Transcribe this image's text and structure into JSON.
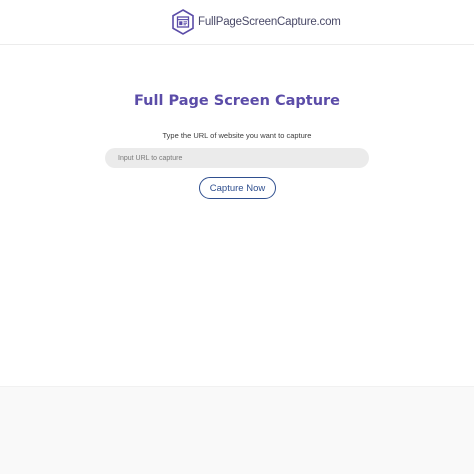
{
  "header": {
    "logo_text": "FullPageScreenCapture.com",
    "logo_icon": "browser-window-hexagon-icon",
    "logo_color": "#5b4ca8"
  },
  "main": {
    "title": "Full Page Screen Capture",
    "subtitle": "Type the URL of website you want to capture",
    "url_input": {
      "value": "",
      "placeholder": "Input URL to capture"
    },
    "capture_button_label": "Capture Now"
  },
  "colors": {
    "title": "#5b4ca8",
    "button": "#2f4f8f",
    "input_background": "#ebebeb"
  }
}
